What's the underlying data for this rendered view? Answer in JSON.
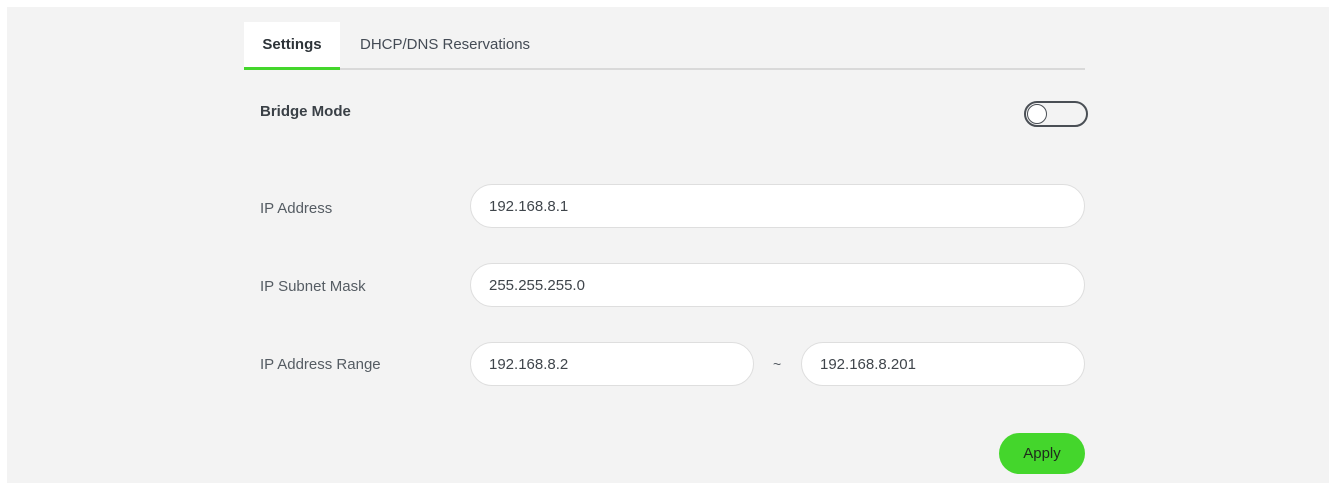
{
  "tabs": {
    "settings": "Settings",
    "reservations": "DHCP/DNS Reservations"
  },
  "bridge_mode": {
    "label": "Bridge Mode",
    "enabled": false
  },
  "ip_address": {
    "label": "IP Address",
    "value": "192.168.8.1"
  },
  "subnet_mask": {
    "label": "IP Subnet Mask",
    "value": "255.255.255.0"
  },
  "ip_range": {
    "label": "IP Address Range",
    "start": "192.168.8.2",
    "separator": "~",
    "end": "192.168.8.201"
  },
  "actions": {
    "apply_label": "Apply"
  },
  "colors": {
    "accent": "#44d62c",
    "panel_background": "#f3f3f3"
  }
}
